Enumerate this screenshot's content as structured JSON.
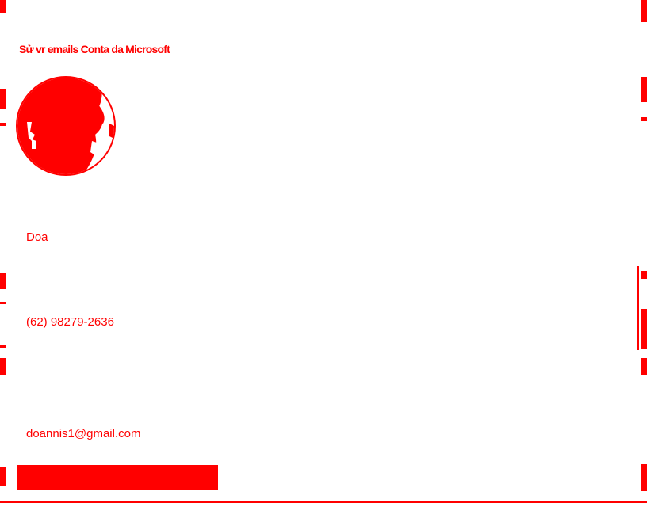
{
  "header": {
    "title": "Sử vr emails Conta da Microsoft"
  },
  "profile": {
    "avatar_icon": "user-avatar",
    "name": "Doa",
    "phone": "(62) 98279-2636",
    "email": "doannis1@gmail.com"
  },
  "action": {
    "label": ""
  },
  "colors": {
    "accent": "#ff0000",
    "background": "#ffffff"
  }
}
